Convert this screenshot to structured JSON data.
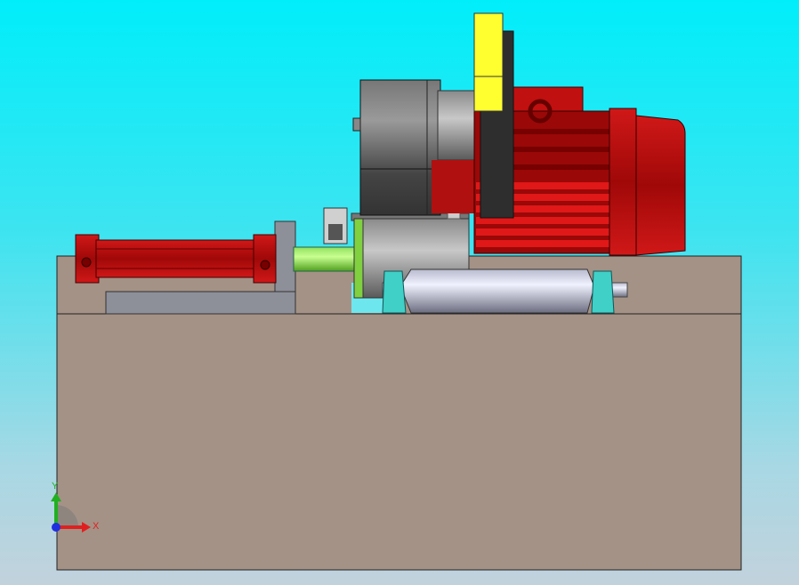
{
  "viewport": {
    "background_top": "#00eefa",
    "background_bottom": "#c2d2dc"
  },
  "model": {
    "colors": {
      "base": "#a49286",
      "bracket": "#8d8f99",
      "cylinder": "#b01010",
      "rod": "#70d040",
      "motor": "#c01010",
      "gearbox": "#6a6a6a",
      "plate": "#ffff30",
      "pulley": "#2e2e2e",
      "roller": "#c8cad8",
      "bearing": "#40d0c8"
    }
  },
  "triad": {
    "x_label": "X",
    "y_label": "Y",
    "x_color": "#e02020",
    "y_color": "#20b020",
    "z_color": "#2030e0"
  }
}
